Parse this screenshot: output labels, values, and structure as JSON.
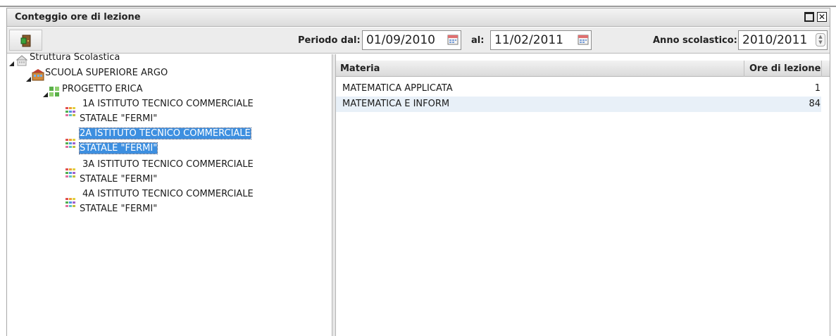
{
  "window": {
    "title": "Conteggio ore di lezione"
  },
  "toolbar": {
    "exit_icon": "exit-door-icon",
    "periodo_label": "Periodo dal:",
    "date_from": "01/09/2010",
    "al_label": "al:",
    "date_to": "11/02/2011",
    "anno_label": "Anno scolastico:",
    "anno_value": "2010/2011"
  },
  "tree": {
    "root": "Struttura Scolastica",
    "school": "SCUOLA SUPERIORE ARGO",
    "project": "PROGETTO ERICA",
    "classes": [
      {
        "line1": "1A ISTITUTO TECNICO COMMERCIALE",
        "line2": "STATALE \"FERMI\""
      },
      {
        "line1": "2A ISTITUTO TECNICO COMMERCIALE",
        "line2": "STATALE \"FERMI\""
      },
      {
        "line1": "3A ISTITUTO TECNICO COMMERCIALE",
        "line2": "STATALE \"FERMI\""
      },
      {
        "line1": "4A ISTITUTO TECNICO COMMERCIALE",
        "line2": "STATALE \"FERMI\""
      }
    ],
    "selected_index": 1
  },
  "table": {
    "headers": [
      "Materia",
      "Ore di lezione"
    ],
    "rows": [
      [
        "MATEMATICA APPLICATA",
        "1"
      ],
      [
        "MATEMATICA E INFORM",
        "84"
      ]
    ]
  },
  "colors": {
    "selection": "#3d8fe0",
    "alt_row": "#e8f0f8"
  }
}
